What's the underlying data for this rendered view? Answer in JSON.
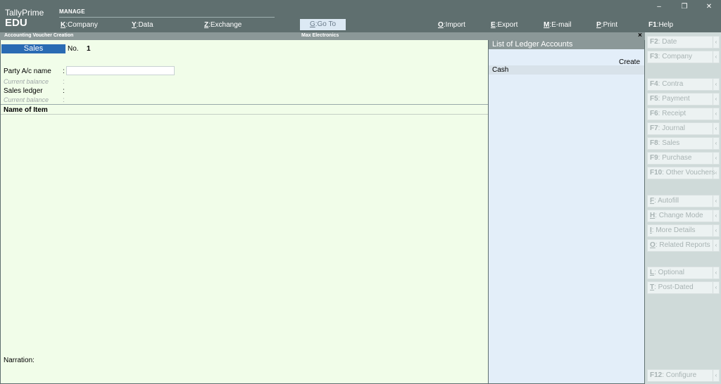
{
  "app": {
    "name": "TallyPrime",
    "edition": "EDU"
  },
  "manage_label": "MANAGE",
  "top_menu": [
    {
      "key": "K",
      "label": "Company"
    },
    {
      "key": "Y",
      "label": "Data"
    },
    {
      "key": "Z",
      "label": "Exchange"
    },
    {
      "key": "O",
      "label": "Import"
    },
    {
      "key": "E",
      "label": "Export"
    },
    {
      "key": "M",
      "label": "E-mail"
    },
    {
      "key": "P",
      "label": "Print"
    },
    {
      "key": "F1",
      "label": "Help"
    }
  ],
  "goto": {
    "key": "G",
    "label": "Go To"
  },
  "window_controls": {
    "minimize": "–",
    "restore": "❐",
    "close": "✕"
  },
  "strip": {
    "title": "Accounting Voucher Creation",
    "company": "Max Electronics",
    "close": "×"
  },
  "voucher": {
    "type": "Sales",
    "no_label": "No.",
    "no_value": "1",
    "fields": {
      "party_label": "Party A/c name",
      "current_balance_label": "Current balance",
      "sales_ledger_label": "Sales ledger",
      "colon": ":"
    },
    "party_value": "",
    "items_header": "Name of Item",
    "narration_label": "Narration:"
  },
  "ledger_list": {
    "title": "List of Ledger Accounts",
    "create_label": "Create",
    "items": [
      "Cash"
    ]
  },
  "side_buttons": {
    "f2": {
      "key": "F2",
      "label": "Date"
    },
    "f3": {
      "key": "F3",
      "label": "Company"
    },
    "f4": {
      "key": "F4",
      "label": "Contra"
    },
    "f5": {
      "key": "F5",
      "label": "Payment"
    },
    "f6": {
      "key": "F6",
      "label": "Receipt"
    },
    "f7": {
      "key": "F7",
      "label": "Journal"
    },
    "f8": {
      "key": "F8",
      "label": "Sales"
    },
    "f9": {
      "key": "F9",
      "label": "Purchase"
    },
    "f10": {
      "key": "F10",
      "label": "Other Vouchers"
    },
    "autofill": {
      "key": "F",
      "label": "Autofill"
    },
    "change_mode": {
      "key": "H",
      "label": "Change Mode"
    },
    "more_details": {
      "key": "I",
      "label": "More Details"
    },
    "related_reports": {
      "key": "O",
      "label": "Related Reports"
    },
    "optional": {
      "key": "L",
      "label": "Optional"
    },
    "post_dated": {
      "key": "T",
      "label": "Post-Dated"
    },
    "f12": {
      "key": "F12",
      "label": "Configure"
    },
    "arrow": "‹",
    "separator": ":"
  },
  "colors": {
    "accent": "#2a6bb3",
    "topbar": "#5f6f6f",
    "voucher_bg": "#f1fde9",
    "list_bg": "#e3eef9"
  }
}
